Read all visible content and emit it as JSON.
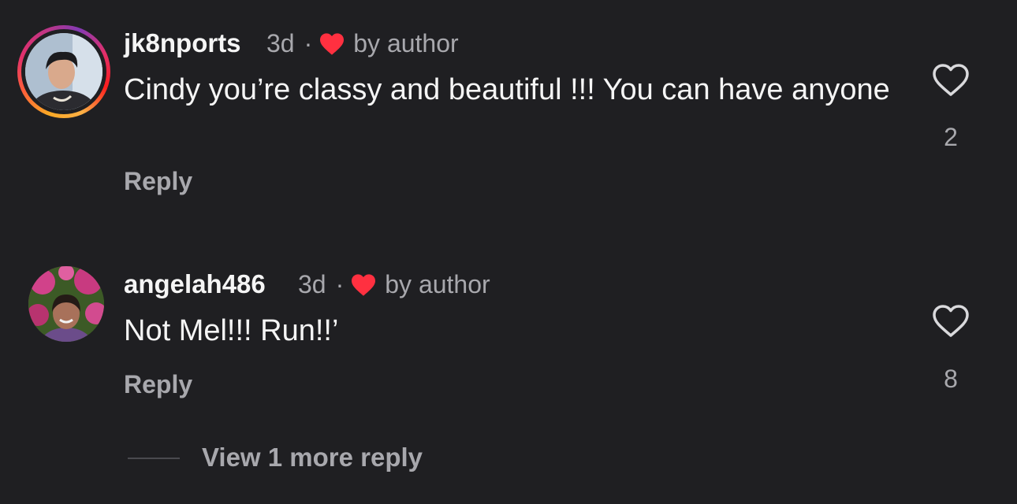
{
  "comments": [
    {
      "username": "jk8nports",
      "age": "3d",
      "separator": "·",
      "liked_by": "by author",
      "text": "Cindy you’re classy and beautiful !!! You can have anyone",
      "reply_label": "Reply",
      "like_count": "2",
      "avatar": "profile-photo",
      "has_story_ring": true
    },
    {
      "username": "angelah486",
      "age": "3d",
      "separator": "·",
      "liked_by": "by author",
      "text": "Not Mel!!! Run!!’",
      "reply_label": "Reply",
      "like_count": "8",
      "avatar": "profile-photo",
      "has_story_ring": false
    }
  ],
  "view_more_label": "View 1 more reply",
  "colors": {
    "background": "#1f1f22",
    "primary_text": "#f5f5f5",
    "secondary_text": "#a8a8ad",
    "heart_red": "#ff3040"
  },
  "icons": {
    "author_like": "heart-icon",
    "like_button": "heart-outline-icon"
  }
}
